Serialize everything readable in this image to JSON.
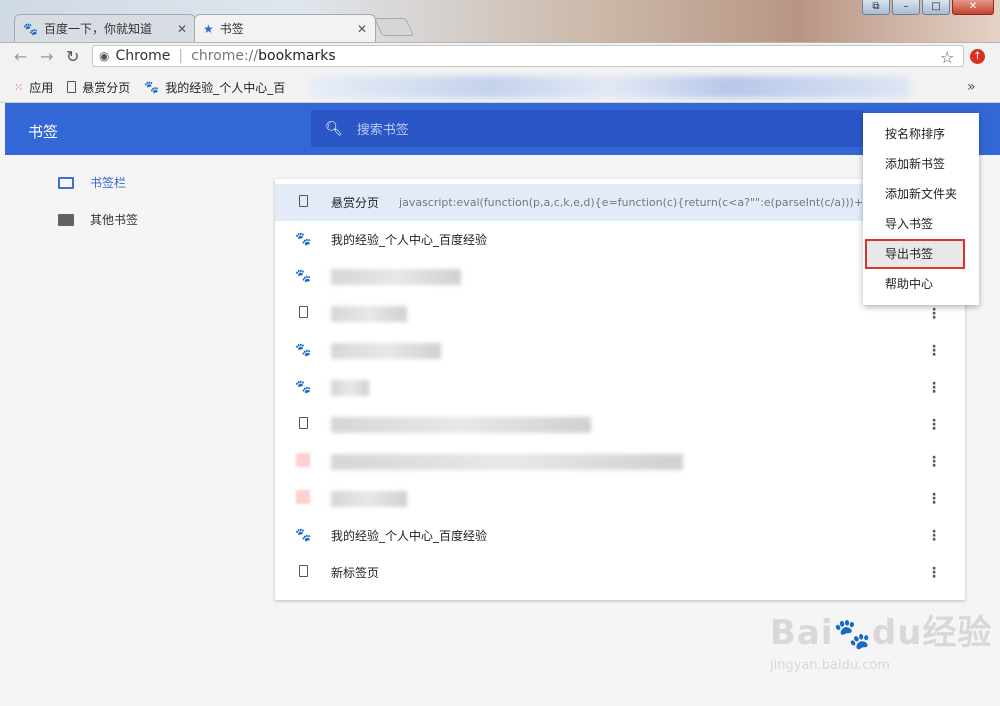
{
  "tabs": [
    {
      "title": "百度一下，你就知道",
      "icon": "baidu-paw-icon",
      "active": false
    },
    {
      "title": "书签",
      "icon": "star-icon",
      "active": true
    }
  ],
  "omnibox": {
    "chip": "Chrome",
    "url_scheme": "chrome://",
    "url_host": "bookmarks"
  },
  "bookmarks_bar": [
    {
      "label": "应用",
      "icon": "apps-grid-icon"
    },
    {
      "label": "悬赏分页",
      "icon": "page-icon"
    },
    {
      "label": "我的经验_个人中心_百",
      "icon": "baidu-paw-icon"
    }
  ],
  "header": {
    "title": "书签",
    "search_placeholder": "搜索书签"
  },
  "nav": [
    {
      "label": "书签栏",
      "icon": "folder-open-icon",
      "active": true
    },
    {
      "label": "其他书签",
      "icon": "folder-icon",
      "active": false
    }
  ],
  "rows": [
    {
      "title": "悬赏分页",
      "url": "javascript:eval(function(p,a,c,k,e,d){e=function(c){return(c<a?\"\":e(parseInt(c/a)))+((c=c%",
      "icon": "page-icon"
    },
    {
      "title": "我的经验_个人中心_百度经验",
      "url": "",
      "icon": "baidu-paw-icon"
    },
    {
      "title": "",
      "url": "",
      "icon": "baidu-paw-icon"
    },
    {
      "title": "",
      "url": "",
      "icon": "page-icon"
    },
    {
      "title": "",
      "url": "",
      "icon": "baidu-paw-icon"
    },
    {
      "title": "",
      "url": "",
      "icon": "baidu-paw-icon"
    },
    {
      "title": "",
      "url": "",
      "icon": "page-icon"
    },
    {
      "title": "",
      "url": "",
      "icon": "favicon-icon"
    },
    {
      "title": "",
      "url": "",
      "icon": "favicon-icon"
    },
    {
      "title": "我的经验_个人中心_百度经验",
      "url": "",
      "icon": "baidu-paw-icon"
    },
    {
      "title": "新标签页",
      "url": "",
      "icon": "page-icon"
    }
  ],
  "menu": [
    "按名称排序",
    "添加新书签",
    "添加新文件夹",
    "导入书签",
    "导出书签",
    "帮助中心"
  ],
  "watermark": {
    "brand": "Bai",
    "brand2": "du",
    "brand3": "经验",
    "url": "jingyan.baidu.com"
  },
  "colors": {
    "header": "#3367d6",
    "search": "#2a56c6",
    "highlight_border": "#e0322c"
  }
}
